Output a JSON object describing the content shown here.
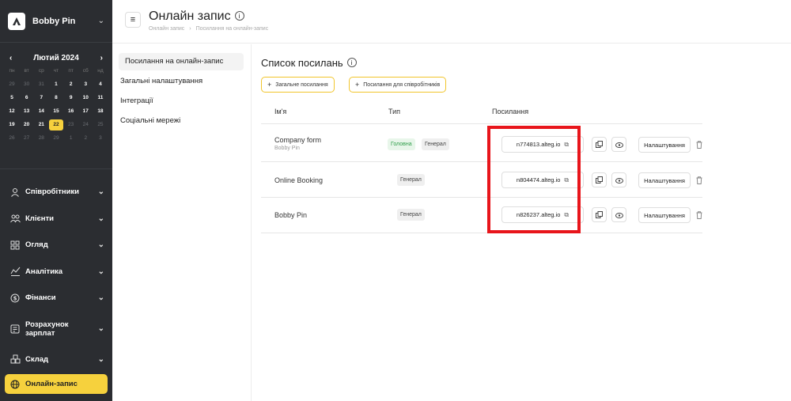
{
  "sidebar": {
    "brand": "Bobby Pin",
    "calendar": {
      "month": "Лютий 2024",
      "weekdays": [
        "пн",
        "вт",
        "ср",
        "чт",
        "пт",
        "сб",
        "нд"
      ],
      "days": [
        {
          "d": "29",
          "m": true
        },
        {
          "d": "30",
          "m": true
        },
        {
          "d": "31",
          "m": true
        },
        {
          "d": "1"
        },
        {
          "d": "2"
        },
        {
          "d": "3"
        },
        {
          "d": "4"
        },
        {
          "d": "5"
        },
        {
          "d": "6"
        },
        {
          "d": "7"
        },
        {
          "d": "8"
        },
        {
          "d": "9"
        },
        {
          "d": "10"
        },
        {
          "d": "11"
        },
        {
          "d": "12"
        },
        {
          "d": "13"
        },
        {
          "d": "14"
        },
        {
          "d": "15"
        },
        {
          "d": "16"
        },
        {
          "d": "17"
        },
        {
          "d": "18"
        },
        {
          "d": "19"
        },
        {
          "d": "20"
        },
        {
          "d": "21"
        },
        {
          "d": "22",
          "t": true
        },
        {
          "d": "23",
          "m": true
        },
        {
          "d": "24",
          "m": true
        },
        {
          "d": "25",
          "m": true
        },
        {
          "d": "26",
          "m": true
        },
        {
          "d": "27",
          "m": true
        },
        {
          "d": "28",
          "m": true
        },
        {
          "d": "29",
          "m": true
        },
        {
          "d": "1",
          "m": true
        },
        {
          "d": "2",
          "m": true
        },
        {
          "d": "3",
          "m": true
        }
      ]
    },
    "nav": [
      {
        "label": "Співробітники",
        "icon": "person-icon"
      },
      {
        "label": "Клієнти",
        "icon": "clients-icon"
      },
      {
        "label": "Огляд",
        "icon": "grid-icon"
      },
      {
        "label": "Аналітика",
        "icon": "chart-icon"
      },
      {
        "label": "Фінанси",
        "icon": "dollar-icon"
      },
      {
        "label": "Розрахунок зарплат",
        "icon": "payroll-icon"
      },
      {
        "label": "Склад",
        "icon": "warehouse-icon"
      }
    ],
    "active": "Онлайн-запис"
  },
  "header": {
    "title": "Онлайн запис",
    "breadcrumb": [
      "Онлайн запис",
      "Посилання на онлайн-запис"
    ]
  },
  "subnav": [
    "Посилання на онлайн-запис",
    "Загальні налаштування",
    "Інтеграції",
    "Соціальні мережі"
  ],
  "main": {
    "title": "Список посилань",
    "buttons": {
      "general": "Загальне посилання",
      "staff": "Посилання для співробітників"
    },
    "columns": {
      "name": "Ім'я",
      "type": "Тип",
      "link": "Посилання"
    },
    "settings_label": "Налаштування",
    "rows": [
      {
        "name": "Company form",
        "sub": "Bobby Pin",
        "tags": [
          "Головна",
          "Генерал"
        ],
        "link": "n774813.alteg.io"
      },
      {
        "name": "Online Booking",
        "sub": "",
        "tags": [
          "Генерал"
        ],
        "link": "n804474.alteg.io"
      },
      {
        "name": "Bobby Pin",
        "sub": "",
        "tags": [
          "Генерал"
        ],
        "link": "n826237.alteg.io"
      }
    ]
  },
  "colors": {
    "accent": "#f6d13d",
    "sidebar": "#2b2d31",
    "highlight": "#e8151b"
  }
}
